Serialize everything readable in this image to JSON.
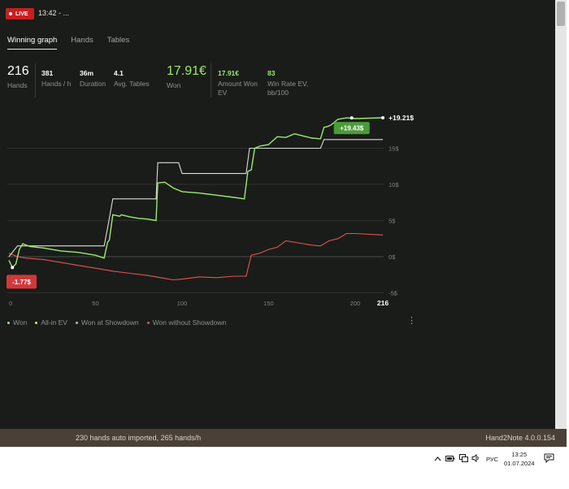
{
  "header": {
    "live_label": "LIVE",
    "session_title": "13:42 - ..."
  },
  "tabs": [
    "Winning graph",
    "Hands",
    "Tables"
  ],
  "stats": {
    "hands": {
      "value": "216",
      "label": "Hands"
    },
    "hands_per_hour": {
      "value": "381",
      "label": "Hands / h"
    },
    "duration": {
      "value": "36m",
      "label": "Duration"
    },
    "avg_tables": {
      "value": "4.1",
      "label": "Avg. Tables"
    },
    "won": {
      "value": "17.91€",
      "label": "Won"
    },
    "amount_won_ev": {
      "value": "17.91€",
      "label_1": "Amount Won",
      "label_2": "EV"
    },
    "win_rate_ev": {
      "value": "83",
      "label_1": "Win Rate EV,",
      "label_2": "bb/100"
    }
  },
  "chart_data": {
    "type": "line",
    "x_tick_labels": [
      "0",
      "50",
      "100",
      "150",
      "200",
      "216"
    ],
    "y_tick_labels": [
      "15$",
      "10$",
      "5$",
      "0$",
      "-5$"
    ],
    "xlim": [
      0,
      216
    ],
    "ylim": [
      -5,
      15
    ],
    "grid": true,
    "legend_position": "bottom-left",
    "series": [
      {
        "name": "Won",
        "color": "#9bea6e",
        "x": [
          0,
          2,
          4,
          6,
          8,
          12,
          20,
          30,
          40,
          50,
          55,
          57,
          58,
          60,
          62,
          64,
          65,
          70,
          75,
          80,
          85,
          86,
          90,
          95,
          100,
          110,
          120,
          130,
          136,
          138,
          140,
          142,
          145,
          150,
          155,
          160,
          165,
          170,
          175,
          180,
          182,
          184,
          186,
          190,
          195,
          200,
          216
        ],
        "y": [
          -0.5,
          -1.5,
          -1.0,
          1.0,
          1.8,
          1.4,
          1.2,
          0.8,
          0.6,
          0.2,
          -0.2,
          2.0,
          2.3,
          5.8,
          5.7,
          5.6,
          5.8,
          5.5,
          5.3,
          5.2,
          5.0,
          10.2,
          10.3,
          9.5,
          9.0,
          8.8,
          8.5,
          8.2,
          8.0,
          11.8,
          12.0,
          15.0,
          15.3,
          15.5,
          16.6,
          16.5,
          17.0,
          16.7,
          16.4,
          16.3,
          17.9,
          18.0,
          18.2,
          19.0,
          19.2,
          19.1,
          19.21
        ]
      },
      {
        "name": "All-in EV",
        "color": "#dcdcdc",
        "x": [
          0,
          5,
          10,
          20,
          50,
          55,
          57,
          60,
          80,
          85,
          86,
          98,
          100,
          120,
          137,
          139,
          145,
          150,
          160,
          170,
          175,
          180,
          182,
          185,
          200,
          216
        ],
        "y": [
          0,
          1.5,
          1.5,
          1.5,
          1.5,
          1.5,
          4.0,
          8.0,
          8.0,
          8.0,
          13.0,
          13.0,
          11.5,
          11.5,
          11.5,
          15.0,
          15.0,
          15.0,
          15.0,
          15.0,
          15.0,
          15.0,
          16.2,
          16.2,
          16.2,
          16.2
        ]
      },
      {
        "name": "Won at Showdown",
        "color": "#b5b5b5",
        "x": [],
        "y": []
      },
      {
        "name": "Won without Showdown",
        "color": "#e4534c",
        "x": [
          0,
          5,
          10,
          20,
          30,
          40,
          50,
          60,
          70,
          80,
          90,
          95,
          100,
          110,
          120,
          130,
          137,
          140,
          145,
          150,
          155,
          160,
          170,
          175,
          180,
          185,
          190,
          195,
          200,
          216
        ],
        "y": [
          0.5,
          0.0,
          -0.2,
          -0.4,
          -0.8,
          -1.2,
          -1.6,
          -2.0,
          -2.3,
          -2.6,
          -3.0,
          -3.2,
          -3.1,
          -2.8,
          -2.9,
          -2.7,
          -2.7,
          0.2,
          0.5,
          1.0,
          1.3,
          2.2,
          1.8,
          1.6,
          1.5,
          2.2,
          2.5,
          3.2,
          3.2,
          3.0
        ]
      }
    ],
    "annotations": {
      "end_value": "+19.21$",
      "max_value": "+19.43$",
      "min_value": "-1.77$",
      "colors": {
        "max_badge": "#4c9b3a",
        "min_badge": "#d2383b"
      }
    }
  },
  "menu": {
    "more_label": "⋮"
  },
  "statusbar": {
    "import_status": "230 hands auto imported, 265 hands/h",
    "version": "Hand2Note 4.0.0.154"
  },
  "taskbar": {
    "lang": "РУС",
    "time": "13:25",
    "date": "01.07.2024"
  },
  "icons": [
    "chevron-up-icon",
    "battery-icon",
    "network-icon",
    "speaker-icon",
    "notification-icon"
  ]
}
